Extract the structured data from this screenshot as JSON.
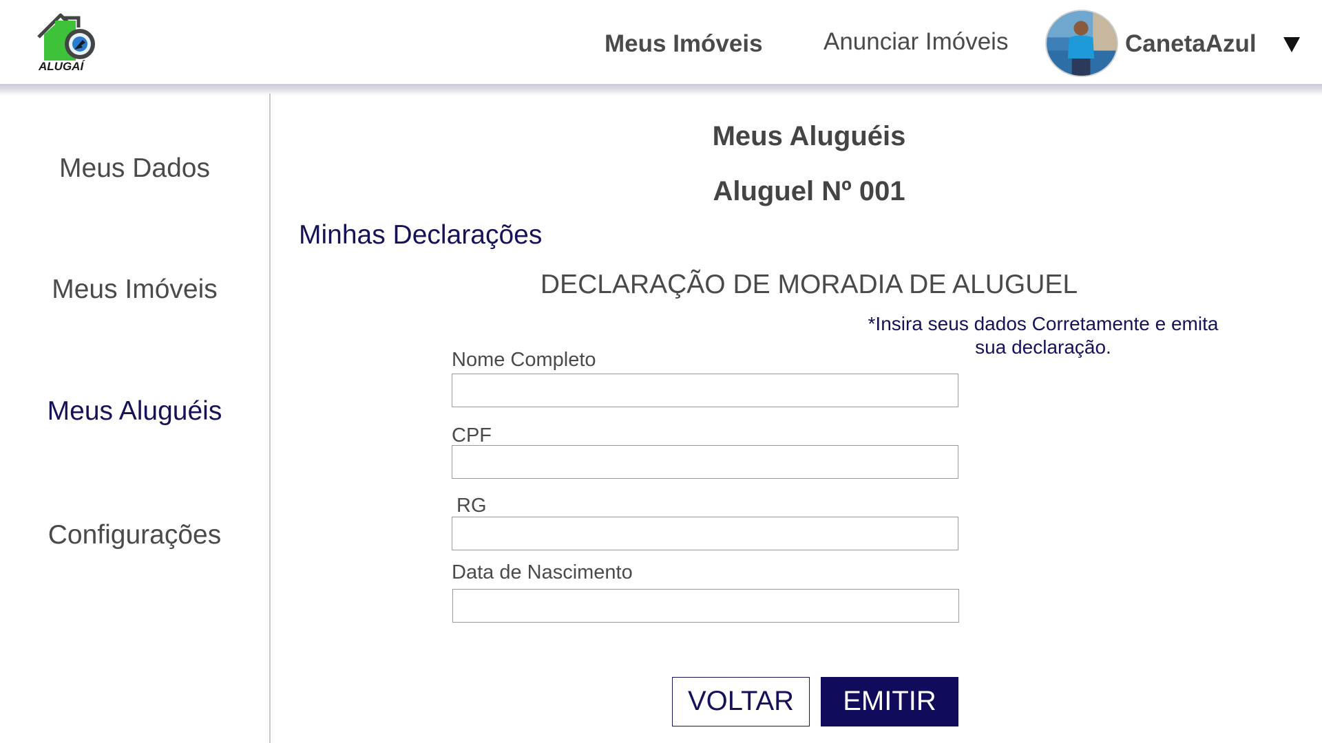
{
  "header": {
    "logo_text": "ALUGAÍ",
    "nav": {
      "meus_imoveis": "Meus Imóveis",
      "anunciar_imoveis": "Anunciar Imóveis"
    },
    "user": {
      "name": "CanetaAzul",
      "caret": "▼"
    }
  },
  "sidebar": {
    "items": [
      {
        "label": "Meus Dados",
        "active": false
      },
      {
        "label": "Meus Imóveis",
        "active": false
      },
      {
        "label": "Meus Aluguéis",
        "active": true
      },
      {
        "label": "Configurações",
        "active": false
      }
    ]
  },
  "main": {
    "title": "Meus Aluguéis",
    "subtitle": "Aluguel Nº 001",
    "section_title": "Minhas Declarações",
    "document_title": "DECLARAÇÃO DE MORADIA DE ALUGUEL",
    "note": "*Insira seus dados Corretamente e emita sua declaração.",
    "form": {
      "nome_label": "Nome Completo",
      "nome_value": "",
      "cpf_label": "CPF",
      "cpf_value": "",
      "rg_label": "RG",
      "rg_value": "",
      "data_label": "Data de Nascimento",
      "data_value": ""
    },
    "buttons": {
      "voltar": "VOLTAR",
      "emitir": "EMITIR"
    }
  },
  "colors": {
    "accent_navy": "#15125a",
    "button_fill": "#100b5a",
    "logo_green": "#3ec23a",
    "text_gray": "#4a4a4a"
  }
}
